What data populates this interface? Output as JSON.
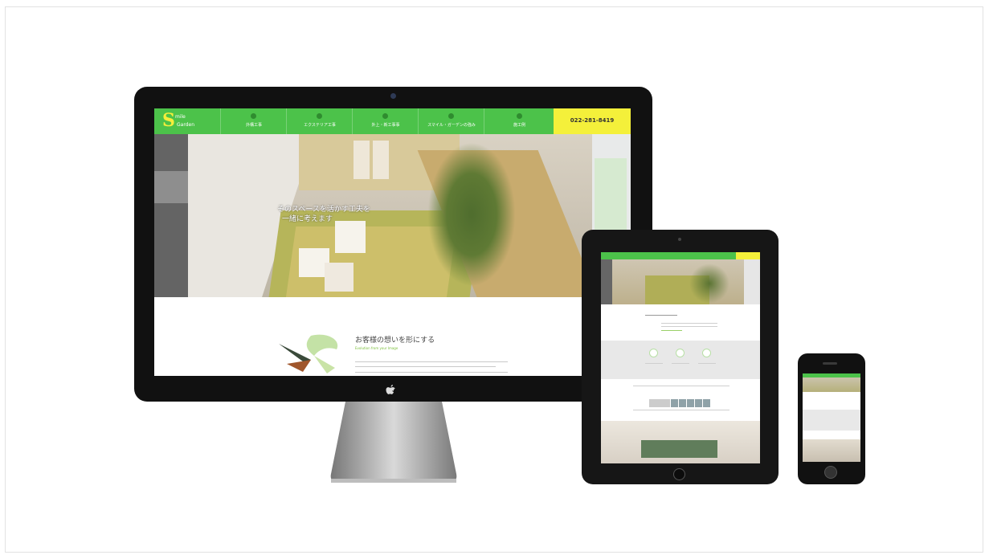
{
  "desktop": {
    "nav": {
      "logo_letter": "S",
      "logo_word1": "mile",
      "logo_word2": "Garden",
      "items": [
        "外構工事",
        "エクステリア工事",
        "外上・新工事事",
        "スマイル・ガーデンの強み",
        "施工例"
      ],
      "phone": "022-281-8419"
    },
    "hero": {
      "line1": "そのスペースを活かす工夫を",
      "line2": "一緒に考えます"
    },
    "intro": {
      "title": "お客様の想いを形にする",
      "subtitle": "Evolution from your Image"
    }
  },
  "colors": {
    "nav_green": "#4cc24a",
    "phone_yellow": "#f4f03a"
  }
}
